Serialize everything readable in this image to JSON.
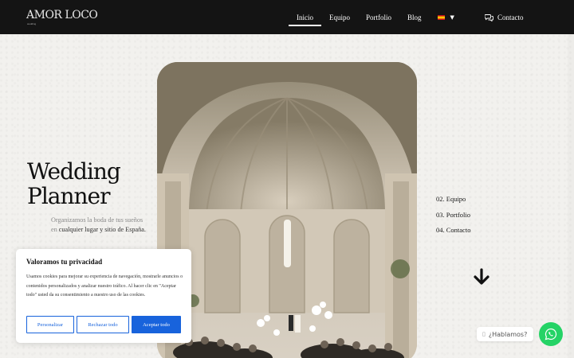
{
  "header": {
    "logo": "AMOR LOCO",
    "logo_sub": "wedding",
    "nav": [
      {
        "label": "Inicio",
        "active": true
      },
      {
        "label": "Equipo",
        "active": false
      },
      {
        "label": "Portfolio",
        "active": false
      },
      {
        "label": "Blog",
        "active": false
      }
    ],
    "language_icon": "spain-flag-icon",
    "contact_label": "Contacto",
    "contact_icon": "chat-bubbles-icon"
  },
  "hero": {
    "title_line1": "Wedding",
    "title_line2": "Planner",
    "subtitle_plain": "Organizamos la boda de tus sueños en",
    "subtitle_bold": "cualquier lugar y sitio de España."
  },
  "side_nav": [
    {
      "label": "02. Equipo"
    },
    {
      "label": "03. Portfolio"
    },
    {
      "label": "04. Contacto"
    }
  ],
  "cookie": {
    "title": "Valoramos tu privacidad",
    "text": "Usamos cookies para mejorar su experiencia de navegación, mostrarle anuncios o contenidos personalizados y analizar nuestro tráfico. Al hacer clic en \"Aceptar todo\" usted da su consentimiento a nuestro uso de las cookies.",
    "btn_customize": "Personalizar",
    "btn_reject": "Rechazar todo",
    "btn_accept": "Aceptar todo"
  },
  "whatsapp": {
    "bubble_text": "¿Hablamos?",
    "icon": "whatsapp-icon"
  },
  "colors": {
    "header_bg": "#141414",
    "accent_blue": "#1863dc",
    "whatsapp_green": "#25d366"
  }
}
